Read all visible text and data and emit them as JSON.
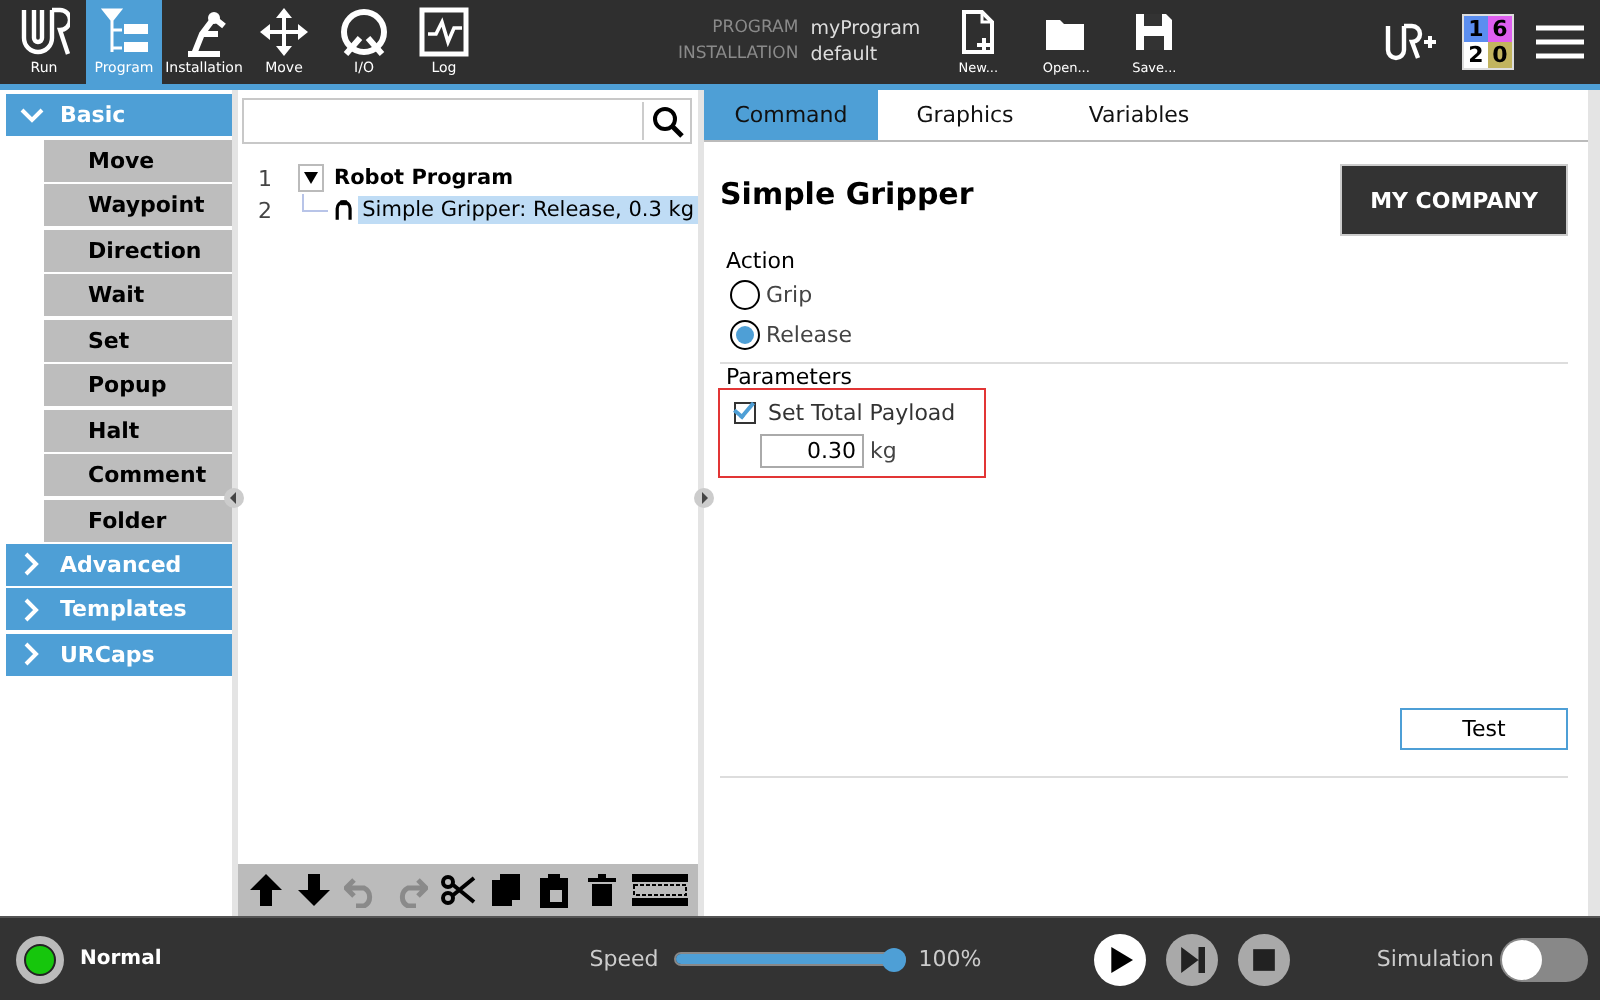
{
  "header": {
    "nav_tabs": [
      {
        "kind": "run",
        "label": "Run",
        "selected": false
      },
      {
        "kind": "program",
        "label": "Program",
        "selected": true
      },
      {
        "kind": "installation",
        "label": "Installation",
        "selected": false
      },
      {
        "kind": "move",
        "label": "Move",
        "selected": false
      },
      {
        "kind": "io",
        "label": "I/O",
        "selected": false
      },
      {
        "kind": "log",
        "label": "Log",
        "selected": false
      }
    ],
    "program_info": [
      {
        "label": "PROGRAM",
        "value": "myProgram"
      },
      {
        "label": "INSTALLATION",
        "value": "default"
      }
    ],
    "file_buttons": [
      {
        "kind": "new",
        "label": "New..."
      },
      {
        "kind": "open",
        "label": "Open..."
      },
      {
        "kind": "save",
        "label": "Save..."
      }
    ],
    "counters": [
      {
        "value": "1",
        "color": "#5b8ef0"
      },
      {
        "value": "6",
        "color": "#df5ff0"
      },
      {
        "value": "2",
        "color": "#ffffff"
      },
      {
        "value": "0",
        "color": "#c2b45e"
      }
    ]
  },
  "sidebar": {
    "groups": [
      {
        "label": "Basic",
        "expanded": true,
        "children": [
          {
            "label": "Move"
          },
          {
            "label": "Waypoint"
          },
          {
            "label": "Direction"
          },
          {
            "label": "Wait"
          },
          {
            "label": "Set"
          },
          {
            "label": "Popup"
          },
          {
            "label": "Halt"
          },
          {
            "label": "Comment"
          },
          {
            "label": "Folder"
          }
        ]
      },
      {
        "label": "Advanced",
        "expanded": false
      },
      {
        "label": "Templates",
        "expanded": false
      },
      {
        "label": "URCaps",
        "expanded": false
      }
    ]
  },
  "program_tree": {
    "rows": [
      {
        "number": "1",
        "label": "Robot Program",
        "expanded": true,
        "selected": false,
        "children": [
          {
            "number": "2",
            "label": "Simple Gripper: Release, 0.3 kg",
            "selected": true
          }
        ]
      }
    ],
    "toolbar": [
      {
        "kind": "up",
        "disabled": false
      },
      {
        "kind": "down",
        "disabled": false
      },
      {
        "kind": "undo",
        "disabled": true
      },
      {
        "kind": "redo",
        "disabled": true
      },
      {
        "kind": "cut",
        "disabled": false
      },
      {
        "kind": "copy",
        "disabled": false
      },
      {
        "kind": "paste",
        "disabled": false
      },
      {
        "kind": "delete",
        "disabled": false
      },
      {
        "kind": "suppress",
        "disabled": false
      }
    ]
  },
  "command_panel": {
    "tabs": [
      {
        "label": "Command",
        "selected": true
      },
      {
        "label": "Graphics",
        "selected": false
      },
      {
        "label": "Variables",
        "selected": false
      }
    ],
    "title": "Simple Gripper",
    "logo": "MY COMPANY",
    "action": {
      "label": "Action",
      "options": [
        {
          "label": "Grip",
          "selected": false
        },
        {
          "label": "Release",
          "selected": true
        }
      ]
    },
    "parameters": {
      "label": "Parameters",
      "highlighted": true,
      "payload": {
        "label": "Set Total Payload",
        "checked": true,
        "value": "0.30",
        "unit": "kg"
      }
    },
    "test_button": "Test"
  },
  "footer": {
    "status": {
      "label": "Normal",
      "color": "#16c60c"
    },
    "speed": {
      "label": "Speed",
      "level": 1.0,
      "reading": "100%"
    },
    "controls": [
      {
        "kind": "play",
        "disabled": false
      },
      {
        "kind": "step",
        "disabled": true
      },
      {
        "kind": "stop",
        "disabled": true
      }
    ],
    "simulation": {
      "label": "Simulation",
      "on": false
    }
  }
}
